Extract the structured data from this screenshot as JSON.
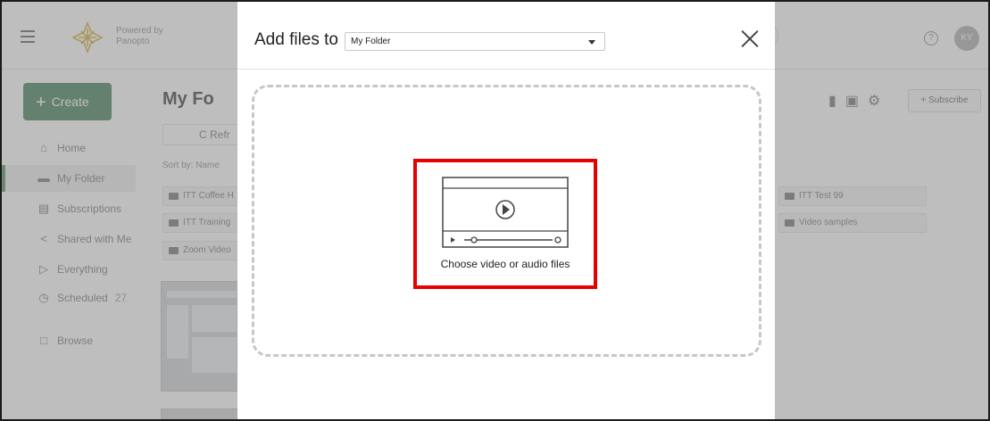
{
  "app": {
    "powered_by": "Powered by",
    "brand": "Panopto",
    "avatar_initials": "KY",
    "help_symbol": "?"
  },
  "sidebar": {
    "create_label": "Create",
    "items": [
      {
        "label": "Home",
        "icon": "home-icon"
      },
      {
        "label": "My Folder",
        "icon": "folder-icon",
        "active": true
      },
      {
        "label": "Subscriptions",
        "icon": "subscriptions-icon"
      },
      {
        "label": "Shared with Me",
        "icon": "share-icon"
      },
      {
        "label": "Everything",
        "icon": "everything-icon"
      },
      {
        "label": "Scheduled",
        "icon": "clock-icon",
        "count": "27"
      },
      {
        "label": "Browse",
        "icon": "browse-folder-icon"
      }
    ]
  },
  "main": {
    "folder_title": "My Fo",
    "refresh_label": "C Refr",
    "sort_by": "Sort by:  Name",
    "folders_left": [
      "ITT Coffee H",
      "ITT Training",
      "Zoom Video"
    ],
    "folders_right": [
      "ITT Test 99",
      "Video samples"
    ],
    "subscribe_label": "+ Subscribe"
  },
  "modal": {
    "title": "Add files to",
    "folder_select_value": "My Folder",
    "choose_label": "Choose video or audio files",
    "highlight_color": "#e60000"
  },
  "colors": {
    "accent_green": "#5c8f6f",
    "overlay": "rgba(110,110,110,0.45)"
  }
}
